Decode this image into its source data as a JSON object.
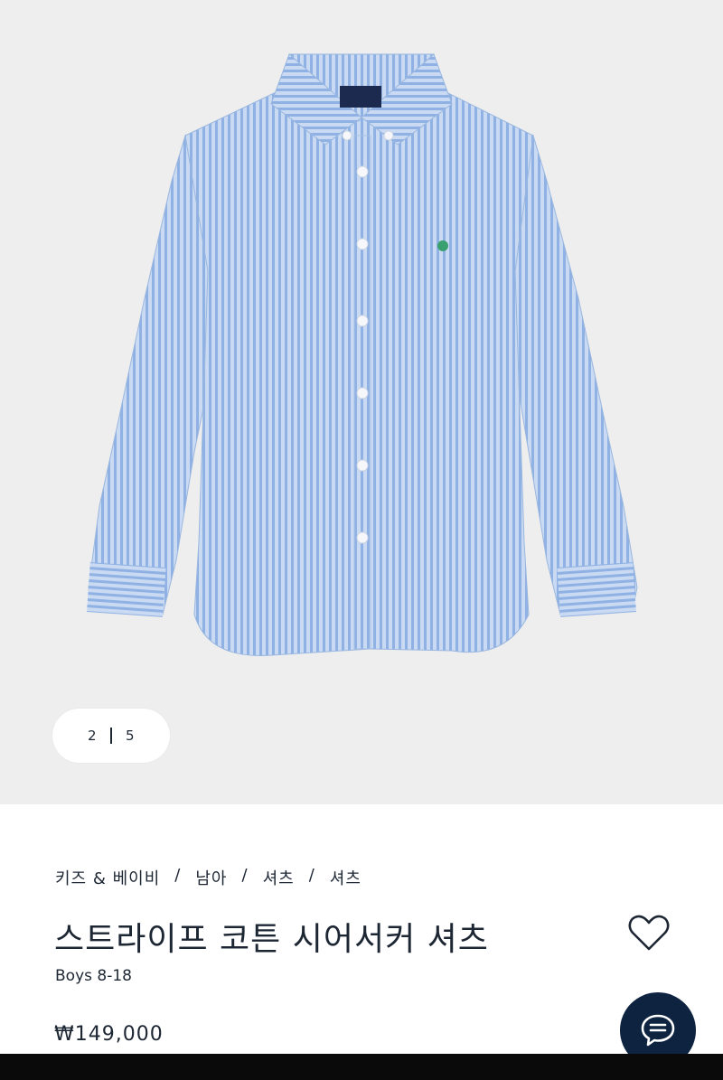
{
  "gallery": {
    "current": "2",
    "total": "5"
  },
  "product": {
    "breadcrumb": [
      "키즈 & 베이비",
      "남아",
      "셔츠",
      "셔츠"
    ],
    "title": "스트라이프 코튼 시어서커 셔츠",
    "subtitle": "Boys 8-18",
    "price": "₩149,000"
  },
  "icons": {
    "wishlist": "heart-icon",
    "chat": "chat-bubble-icon"
  },
  "colors": {
    "navy": "#0e2340",
    "shirt_blue": "#9fbde6",
    "background": "#efeeee"
  }
}
